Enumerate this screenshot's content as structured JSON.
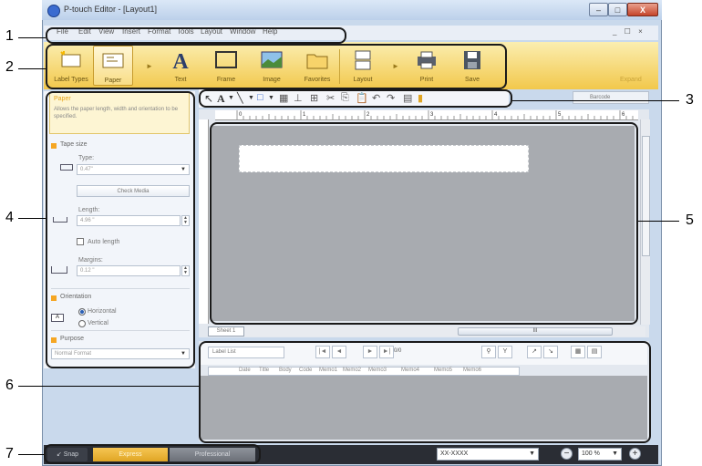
{
  "window": {
    "title": "P-touch Editor - [Layout1]",
    "controls": {
      "minimize": "–",
      "maximize": "□",
      "close": "X"
    },
    "mdi_controls": "_ ☐ ×"
  },
  "menu": {
    "items": [
      "File",
      "Edit",
      "View",
      "Insert",
      "Format",
      "Tools",
      "Layout",
      "Window",
      "Help"
    ]
  },
  "ribbon": {
    "buttons": [
      {
        "label": "Label Types",
        "icon": "label-types-icon"
      },
      {
        "label": "Paper",
        "icon": "paper-icon"
      },
      {
        "label": "Text",
        "icon": "text-icon"
      },
      {
        "label": "Frame",
        "icon": "frame-icon"
      },
      {
        "label": "Image",
        "icon": "image-icon"
      },
      {
        "label": "Favorites",
        "icon": "favorites-icon"
      },
      {
        "label": "Layout",
        "icon": "layout-icon"
      },
      {
        "label": "Print",
        "icon": "print-icon"
      },
      {
        "label": "Save",
        "icon": "save-icon"
      }
    ],
    "expand_label": "Expand"
  },
  "toolbar": {
    "buttons": [
      "select-arrow",
      "text",
      "line",
      "rectangle",
      "table",
      "tree",
      "align",
      "cut",
      "copy",
      "paste",
      "undo",
      "redo",
      "grid",
      "database"
    ],
    "barcode_label": "Barcode"
  },
  "properties": {
    "title": "Paper",
    "description": "Allows the paper length, width and orientation to be specified.",
    "tape_size_heading": "Tape size",
    "type_label": "Type:",
    "type_value": "0.47\"",
    "check_media": "Check Media",
    "length_label": "Length:",
    "length_value": "4.96 \"",
    "auto_length": "Auto length",
    "margins_label": "Margins:",
    "margins_value": "0.12 \"",
    "orientation_heading": "Orientation",
    "horizontal": "Horizontal",
    "vertical": "Vertical",
    "purpose_heading": "Purpose",
    "purpose_value": "Normal Format"
  },
  "editor": {
    "ruler_labels": [
      "0",
      "1",
      "2",
      "3",
      "4",
      "5",
      "6"
    ],
    "sheet_tab": "Sheet 1",
    "hscroll_mark": "III"
  },
  "database": {
    "label_list": "Label List",
    "record_count": "0/0",
    "columns": [
      "Date",
      "Title",
      "Body",
      "Code",
      "Memo1",
      "Memo2",
      "Memo3",
      "Memo4",
      "Memo5",
      "Memo6"
    ]
  },
  "statusbar": {
    "snap": "Snap",
    "express": "Express",
    "professional": "Professional",
    "printer": "XX-XXXX",
    "zoom": "100 %"
  },
  "callouts": [
    "1",
    "2",
    "3",
    "4",
    "5",
    "6",
    "7"
  ]
}
